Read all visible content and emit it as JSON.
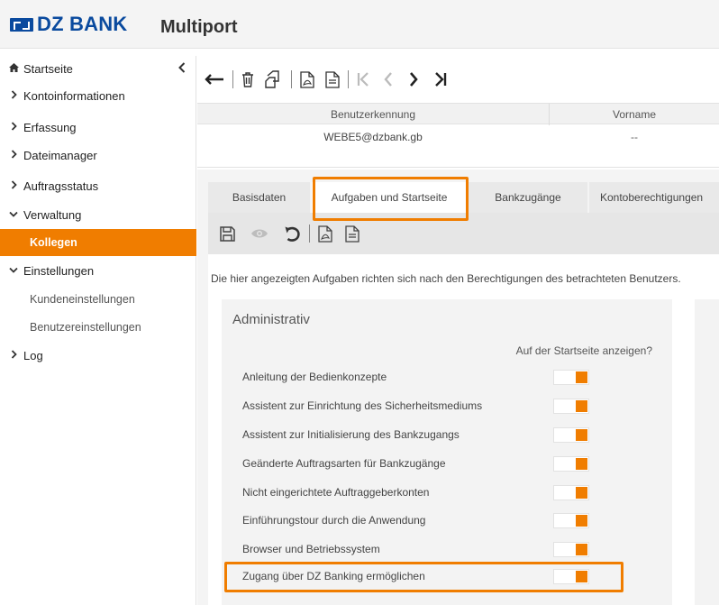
{
  "header": {
    "brand": "DZ BANK",
    "app_title": "Multiport"
  },
  "sidebar": {
    "items": [
      {
        "label": "Startseite",
        "icon": "home-icon"
      },
      {
        "label": "Kontoinformationen",
        "icon": "chevron-right-icon"
      },
      {
        "label": "Erfassung",
        "icon": "chevron-right-icon"
      },
      {
        "label": "Dateimanager",
        "icon": "chevron-right-icon"
      },
      {
        "label": "Auftragsstatus",
        "icon": "chevron-right-icon"
      },
      {
        "label": "Verwaltung",
        "icon": "chevron-down-icon"
      },
      {
        "label": "Kollegen",
        "active": true
      },
      {
        "label": "Einstellungen",
        "icon": "chevron-down-icon"
      },
      {
        "label": "Kundeneinstellungen"
      },
      {
        "label": "Benutzereinstellungen"
      },
      {
        "label": "Log",
        "icon": "chevron-right-icon"
      }
    ],
    "collapse_icon": "chevron-left-icon"
  },
  "toolbar": {
    "icons": [
      "back-arrow-icon",
      "trash-icon",
      "copy-icon",
      "pdf-icon",
      "document-icon",
      "first-page-icon",
      "previous-icon",
      "next-icon",
      "last-page-icon"
    ]
  },
  "user_table": {
    "columns": [
      "Benutzerkennung",
      "Vorname"
    ],
    "row": [
      "WEBE5@dzbank.gb",
      "--"
    ]
  },
  "tabs": [
    {
      "label": "Basisdaten"
    },
    {
      "label": "Aufgaben und Startseite",
      "active": true
    },
    {
      "label": "Bankzugänge"
    },
    {
      "label": "Kontoberechtigungen"
    }
  ],
  "subtoolbar": {
    "icons": [
      "save-icon",
      "eye-icon",
      "undo-icon",
      "pdf-icon",
      "document-icon"
    ]
  },
  "info_text": "Die hier angezeigten Aufgaben richten sich nach den Berechtigungen des betrachteten Benutzers.",
  "admin": {
    "title": "Administrativ",
    "column_header": "Auf der Startseite anzeigen?",
    "tasks": [
      {
        "label": "Anleitung der Bedienkonzepte",
        "enabled": true
      },
      {
        "label": "Assistent zur Einrichtung des Sicherheitsmediums",
        "enabled": true
      },
      {
        "label": "Assistent zur Initialisierung des Bankzugangs",
        "enabled": true
      },
      {
        "label": "Geänderte Auftragsarten für Bankzugänge",
        "enabled": true
      },
      {
        "label": "Nicht eingerichtete Auftraggeberkonten",
        "enabled": true
      },
      {
        "label": "Einführungstour durch die Anwendung",
        "enabled": true
      },
      {
        "label": "Browser und Betriebssystem",
        "enabled": true
      },
      {
        "label": "Zugang über DZ Banking ermöglichen",
        "enabled": true
      }
    ]
  },
  "colors": {
    "accent": "#f07d00",
    "brand": "#0a4a9e"
  }
}
